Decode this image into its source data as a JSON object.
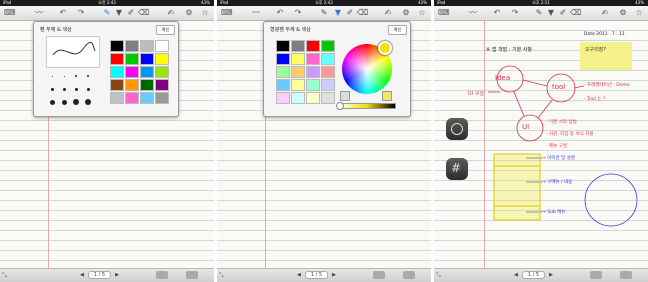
{
  "status": {
    "carrier": "iPad",
    "times": [
      "오전 2:43",
      "오후 2:43",
      "오후 2:11"
    ],
    "battery": "43%"
  },
  "popup1": {
    "title": "펜 두께 & 색상",
    "ok_label": "확인"
  },
  "popup2": {
    "title": "형광펜 두께 & 색상",
    "ok_label": "확인"
  },
  "pager": {
    "label": "1 / 5"
  },
  "note": {
    "date": "Date 2011 . 7 . 11",
    "heading": "※ 앱 개발 : 기본 사항",
    "sticky": "오구리장?",
    "node_idea": "Idea",
    "node_tool": "tool",
    "node_ui": "UI",
    "left_label": "UI 구성",
    "tool_note_1": "- 프레젠테이션 : Demo",
    "tool_note_2": "- Tool 는 ?",
    "ui_note_1": "- 기본 시작 방법",
    "ui_note_2": "- 사진, 타임 등 서식 지원",
    "ui_note_3": "- 메뉴 구성",
    "blue_1": "→ 아이콘 및 설명",
    "blue_2": "→ 구메뉴 / 내용",
    "blue_3": "→ Sub 메뉴"
  },
  "colors": {
    "pen_palette": [
      "#000000",
      "#7f7f7f",
      "#bdbdbd",
      "#ffffff",
      "#ff0000",
      "#00c800",
      "#0000ff",
      "#ffff00",
      "#00ffff",
      "#ff00ff",
      "#0096ff",
      "#a0e000",
      "#8b4513",
      "#ff9900",
      "#006600",
      "#800080",
      "#c0c0c0",
      "#ff66cc",
      "#66ccff",
      "#999999"
    ],
    "hl_palette": [
      "#000000",
      "#7f7f7f",
      "#ff0000",
      "#00c800",
      "#0000ff",
      "#ffff66",
      "#ff66cc",
      "#66ffff",
      "#99ff99",
      "#ffcc66",
      "#cc99ff",
      "#ff9999",
      "#66ccff",
      "#ffff99",
      "#99ffcc",
      "#ccccff",
      "#ffccff",
      "#ccffff",
      "#ffffcc",
      "#e0e0e0"
    ]
  }
}
